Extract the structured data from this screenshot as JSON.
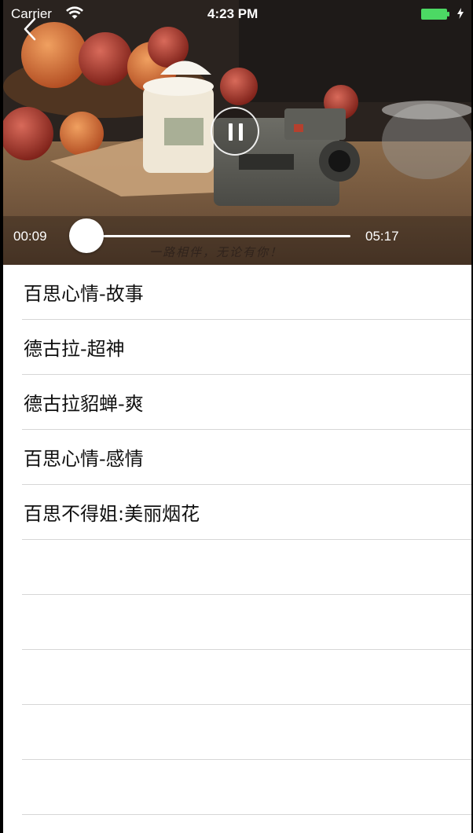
{
  "status_bar": {
    "carrier": "Carrier",
    "time": "4:23 PM",
    "wifi_icon": "wifi-icon",
    "battery_icon": "battery-icon",
    "battery_color": "#4cd964"
  },
  "player": {
    "back_icon": "chevron-left-icon",
    "pause_icon": "pause-icon",
    "current_time": "00:09",
    "total_time": "05:17",
    "progress_fraction": 0.029,
    "progress_color": "#ffe000",
    "subtitle": "一路相伴，无论有你！"
  },
  "playlist": {
    "items": [
      {
        "label": "百思心情-故事"
      },
      {
        "label": "德古拉-超神"
      },
      {
        "label": "德古拉貂蝉-爽"
      },
      {
        "label": "百思心情-感情"
      },
      {
        "label": "百思不得姐:美丽烟花"
      },
      {
        "label": ""
      },
      {
        "label": ""
      },
      {
        "label": ""
      },
      {
        "label": ""
      },
      {
        "label": ""
      },
      {
        "label": ""
      }
    ]
  }
}
